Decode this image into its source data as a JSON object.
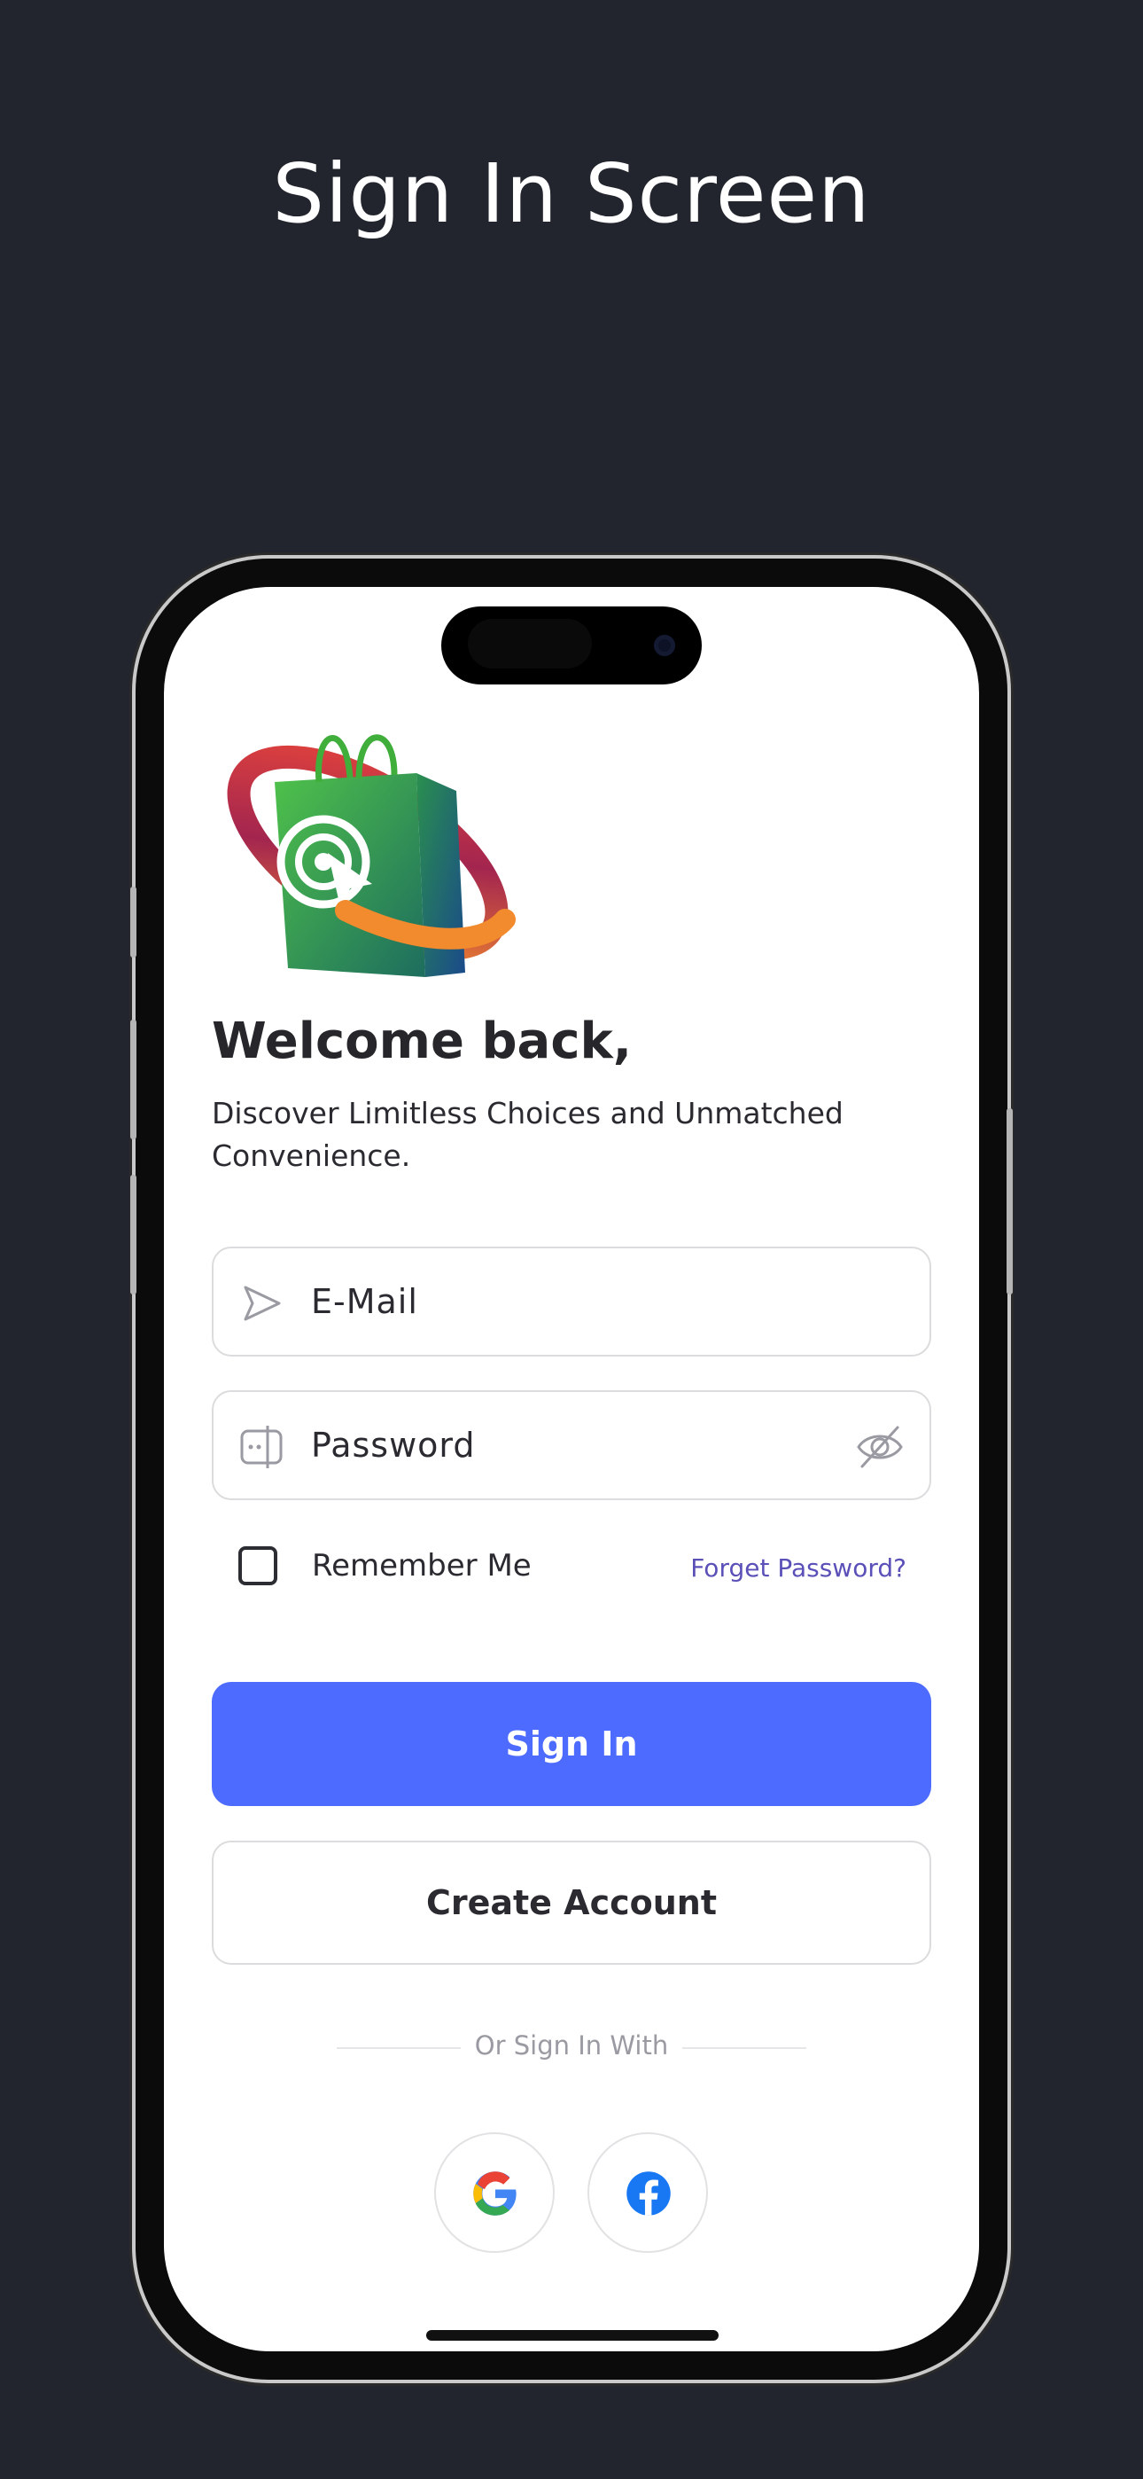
{
  "header": {
    "title": "Sign In Screen"
  },
  "signin": {
    "welcome": "Welcome back,",
    "subtitle": "Discover Limitless Choices and Unmatched Convenience.",
    "email_placeholder": "E-Mail",
    "password_placeholder": "Password",
    "remember_label": "Remember Me",
    "remember_checked": false,
    "forgot_label": "Forget Password?",
    "signin_button": "Sign In",
    "create_account_button": "Create Account",
    "divider_text": "Or Sign In With",
    "social": [
      {
        "name": "google",
        "icon": "google-icon"
      },
      {
        "name": "facebook",
        "icon": "facebook-icon"
      }
    ]
  },
  "colors": {
    "background": "#22252d",
    "primary": "#4d6bfe",
    "link": "#5b50b8",
    "text": "#2a2a30"
  }
}
